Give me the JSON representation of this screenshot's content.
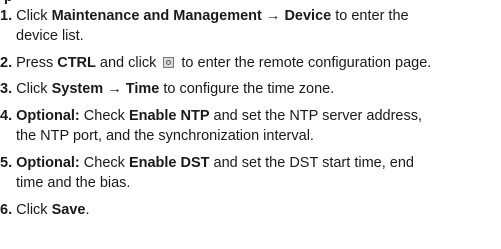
{
  "top_clip": "p",
  "steps": [
    {
      "num": "1.",
      "parts": [
        "Click ",
        "Maintenance and Management",
        " → ",
        "Device",
        " to enter the"
      ],
      "line2": "device list."
    },
    {
      "num": "2.",
      "parts": [
        "Press ",
        "CTRL",
        " and click ",
        " to enter the remote configuration page."
      ]
    },
    {
      "num": "3.",
      "parts": [
        "Click ",
        "System",
        " → ",
        "Time",
        " to configure the time zone."
      ]
    },
    {
      "num": "4.",
      "parts": [
        "Optional:",
        " Check ",
        "Enable NTP",
        " and set the NTP server address,"
      ],
      "line2": "the NTP port, and the synchronization interval."
    },
    {
      "num": "5.",
      "parts": [
        "Optional:",
        " Check ",
        "Enable DST",
        " and set the DST start time, end"
      ],
      "line2": "time and the bias."
    },
    {
      "num": "6.",
      "parts": [
        "Click ",
        "Save",
        "."
      ]
    }
  ],
  "icons": {
    "step2_icon": "gear-icon"
  }
}
